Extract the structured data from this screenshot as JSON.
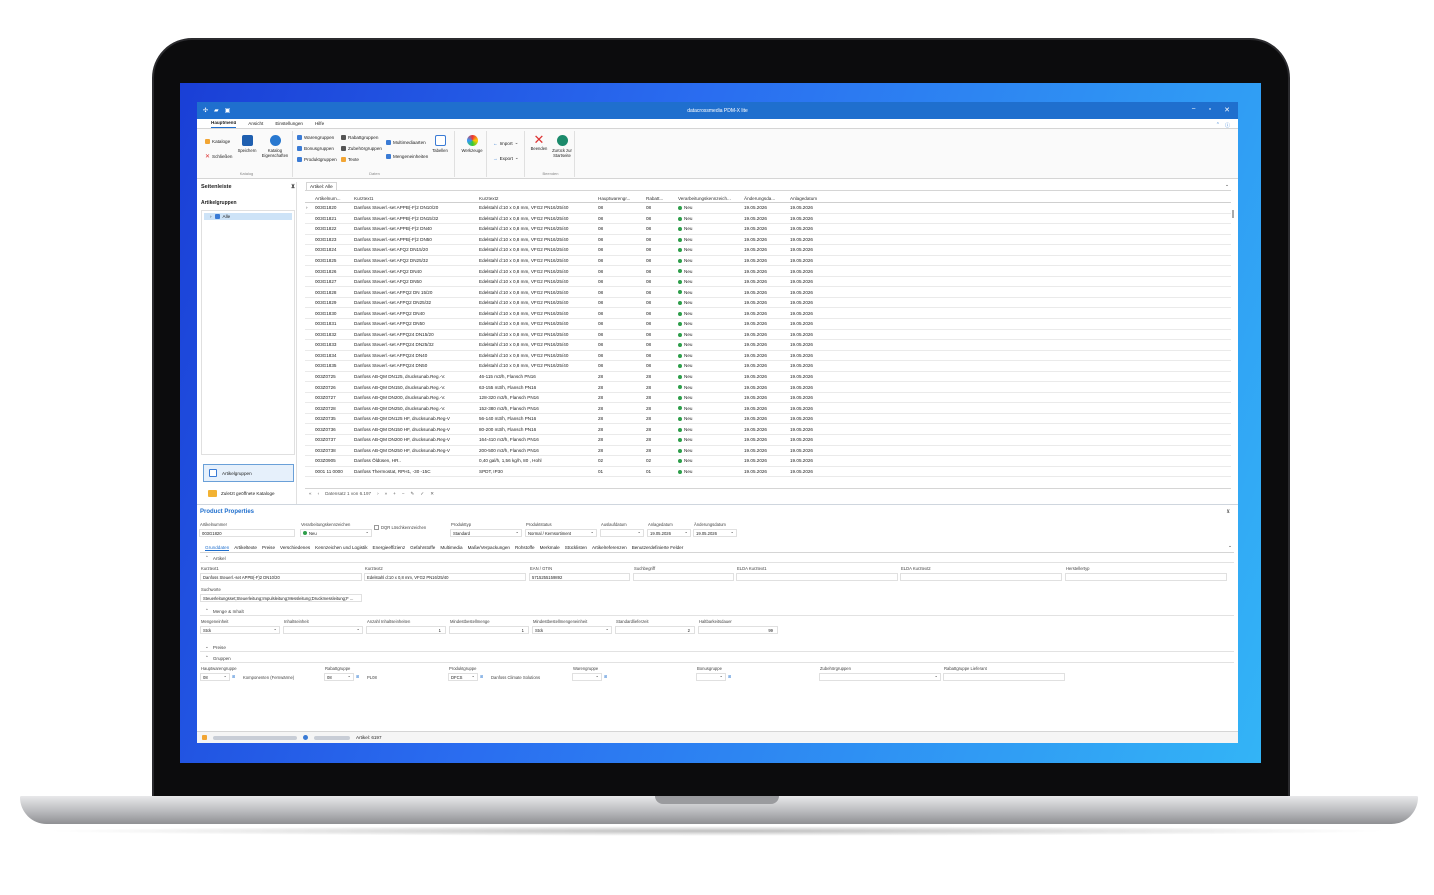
{
  "window": {
    "title": "datacrossmedia PDM-X lite",
    "minimize": "−",
    "restore": "▫",
    "close": "✕"
  },
  "menu": {
    "items": [
      "Hauptmenü",
      "Ansicht",
      "Einstellungen",
      "Hilfe"
    ]
  },
  "ribbon": {
    "katalog": {
      "name": "Katalog",
      "kataloge": "Kataloge",
      "schliessen": "Schließen",
      "speichern": "Speichern",
      "eigenschaften": "Katalog Eigenschaften"
    },
    "daten": {
      "name": "Daten",
      "warengruppen": "Warengruppen",
      "bonusgruppen": "Bonusgruppen",
      "produktgruppen": "Produktgruppen",
      "rabattgruppen": "Rabattgruppen",
      "zubehoergruppen": "Zubehörgruppen",
      "texte": "Texte",
      "multimediaarten": "Multimediaarten",
      "mengeneinheiten": "Mengeneinheiten",
      "tabellen": "Tabellen"
    },
    "werkzeuge": {
      "label": "Werkzeuge"
    },
    "io": {
      "import": "Import",
      "export": "Export"
    },
    "beenden": {
      "name": "Beenden",
      "beenden": "Beenden",
      "zurueck": "Zurück zur Startseite"
    }
  },
  "sidebar": {
    "title": "Seitenleiste",
    "section": "Artikelgruppen",
    "tree_item": "Alle",
    "nav_active": "Artikelgruppen",
    "nav_other": "Zuletzt geöffnete Kataloge"
  },
  "grid": {
    "tab": "Artikel: Alle",
    "columns": [
      "Artikelnum...",
      "Kurztext1",
      "Kurztext2",
      "Hauptwarengr...",
      "Rabatt...",
      "Verarbeitungskennzeich...",
      "Änderungsda...",
      "Anlagedatum"
    ],
    "rows": [
      [
        "003G1820",
        "Danfoss Steuerl.-set APPB(-F)2 DN10/20",
        "Edelstahl d:10 x 0,8 mm, VFG2 PN16/25/40",
        "08",
        "08",
        "Neu",
        "19.05.2026",
        "19.05.2026"
      ],
      [
        "003G1821",
        "Danfoss Steuerl.-set APPB(-F)2 DN15/32",
        "Edelstahl d:10 x 0,8 mm, VFG2 PN16/25/40",
        "08",
        "08",
        "Neu",
        "19.05.2026",
        "19.05.2026"
      ],
      [
        "003G1822",
        "Danfoss Steuerl.-set APPB(-F)2 DN40",
        "Edelstahl d:10 x 0,8 mm, VFG2 PN16/25/40",
        "08",
        "08",
        "Neu",
        "19.05.2026",
        "19.05.2026"
      ],
      [
        "003G1823",
        "Danfoss Steuerl.-set APPB(-F)2 DN50",
        "Edelstahl d:10 x 0,8 mm, VFG2 PN16/25/40",
        "08",
        "08",
        "Neu",
        "19.05.2026",
        "19.05.2026"
      ],
      [
        "003G1824",
        "Danfoss Steuerl.-set AFQ2 DN15/20",
        "Edelstahl d:10 x 0,8 mm, VFG2 PN16/25/40",
        "08",
        "08",
        "Neu",
        "19.05.2026",
        "19.05.2026"
      ],
      [
        "003G1825",
        "Danfoss Steuerl.-set AFQ2 DN25/32",
        "Edelstahl d:10 x 0,8 mm, VFG2 PN16/25/40",
        "08",
        "08",
        "Neu",
        "19.05.2026",
        "19.05.2026"
      ],
      [
        "003G1826",
        "Danfoss Steuerl.-set AFQ2 DN40",
        "Edelstahl d:10 x 0,8 mm, VFG2 PN16/25/40",
        "08",
        "08",
        "Neu",
        "19.05.2026",
        "19.05.2026"
      ],
      [
        "003G1827",
        "Danfoss Steuerl.-set AFQ2 DN50",
        "Edelstahl d:10 x 0,8 mm, VFG2 PN16/25/40",
        "08",
        "08",
        "Neu",
        "19.05.2026",
        "19.05.2026"
      ],
      [
        "003G1828",
        "Danfoss Steuerl.-set AFPQ2 DN 15/20",
        "Edelstahl d:10 x 0,8 mm, VFG2 PN16/25/40",
        "08",
        "08",
        "Neu",
        "19.05.2026",
        "19.05.2026"
      ],
      [
        "003G1829",
        "Danfoss Steuerl.-set AFPQ2 DN25/32",
        "Edelstahl d:10 x 0,8 mm, VFG2 PN16/25/40",
        "08",
        "08",
        "Neu",
        "19.05.2026",
        "19.05.2026"
      ],
      [
        "003G1830",
        "Danfoss Steuerl.-set AFPQ2 DN40",
        "Edelstahl d:10 x 0,8 mm, VFG2 PN16/25/40",
        "08",
        "08",
        "Neu",
        "19.05.2026",
        "19.05.2026"
      ],
      [
        "003G1831",
        "Danfoss Steuerl.-set AFPQ2 DN50",
        "Edelstahl d:10 x 0,8 mm, VFG2 PN16/25/40",
        "08",
        "08",
        "Neu",
        "19.05.2026",
        "19.05.2026"
      ],
      [
        "003G1832",
        "Danfoss Steuerl.-set AFPQ24 DN15/20",
        "Edelstahl d:10 x 0,8 mm, VFG2 PN16/25/40",
        "08",
        "08",
        "Neu",
        "19.05.2026",
        "19.05.2026"
      ],
      [
        "003G1833",
        "Danfoss Steuerl.-set AFPQ24 DN25/32",
        "Edelstahl d:10 x 0,8 mm, VFG2 PN16/25/40",
        "08",
        "08",
        "Neu",
        "19.05.2026",
        "19.05.2026"
      ],
      [
        "003G1834",
        "Danfoss Steuerl.-set AFPQ24 DN40",
        "Edelstahl d:10 x 0,8 mm, VFG2 PN16/25/40",
        "08",
        "08",
        "Neu",
        "19.05.2026",
        "19.05.2026"
      ],
      [
        "003G1835",
        "Danfoss Steuerl.-set AFPQ24 DN50",
        "Edelstahl d:10 x 0,8 mm, VFG2 PN16/25/40",
        "08",
        "08",
        "Neu",
        "19.05.2026",
        "19.05.2026"
      ],
      [
        "003Z0725",
        "Danfoss AB-QM DN125, drucksunab.Reg.-V.",
        "46-115 m3/h, Flansch PN16",
        "28",
        "28",
        "Neu",
        "19.05.2026",
        "19.05.2026"
      ],
      [
        "003Z0726",
        "Danfoss AB-QM DN150, drucksunab.Reg.-V.",
        "63-155 m3/h, Flansch PN16",
        "28",
        "28",
        "Neu",
        "19.05.2026",
        "19.05.2026"
      ],
      [
        "003Z0727",
        "Danfoss AB-QM DN200, drucksunab.Reg.-V.",
        "128-320 m3/h, Flansch PN16",
        "28",
        "28",
        "Neu",
        "19.05.2026",
        "19.05.2026"
      ],
      [
        "003Z0728",
        "Danfoss AB-QM DN250, drucksunab.Reg.-V.",
        "152-380 m3/h, Flansch PN16",
        "28",
        "28",
        "Neu",
        "19.05.2026",
        "19.05.2026"
      ],
      [
        "003Z0735",
        "Danfoss AB-QM DN125 HF, drucksunab.Reg-V",
        "56-140 m3/h, Flansch PN16",
        "28",
        "28",
        "Neu",
        "19.05.2026",
        "19.05.2026"
      ],
      [
        "003Z0736",
        "Danfoss AB-QM DN150 HF, drucksunab.Reg-V",
        "80-200 m3/h, Flansch PN16",
        "28",
        "28",
        "Neu",
        "19.05.2026",
        "19.05.2026"
      ],
      [
        "003Z0737",
        "Danfoss AB-QM DN200 HF, drucksunab.Reg-V",
        "164-410 m3/h, Flansch PN16",
        "28",
        "28",
        "Neu",
        "19.05.2026",
        "19.05.2026"
      ],
      [
        "003Z0738",
        "Danfoss AB-QM DN250 HF, drucksunab.Reg-V",
        "200-500 m3/h, Flansch PN16",
        "28",
        "28",
        "Neu",
        "19.05.2026",
        "19.05.2026"
      ],
      [
        "003Z0905",
        "Danfoss Öldüsen, HR..",
        "0,40 gal/h, 1,56 kg/h, 80 , Hohl",
        "02",
        "02",
        "Neu",
        "19.05.2026",
        "19.05.2026"
      ],
      [
        "0001 11 0000",
        "Danfoss Thermostat, RPH1, -30 -15C",
        "SPDT, IP30",
        "01",
        "01",
        "Neu",
        "19.05.2026",
        "19.05.2026"
      ]
    ],
    "pager": {
      "text": "Datensatz 1 von 6.197",
      "nav_first": "«",
      "nav_prev": "‹",
      "nav_next": "›",
      "nav_last": "»"
    }
  },
  "properties": {
    "title": "Product Properties",
    "artikelnummer": {
      "label": "Artikelnummer",
      "value": "003G1820"
    },
    "verarbeitung": {
      "label": "Verarbeitungskennzeichen",
      "value": "Neu"
    },
    "dqr": {
      "label": "DQR Löschkennzeichen"
    },
    "produkttyp": {
      "label": "Produkttyp",
      "value": "Standard"
    },
    "produktstatus": {
      "label": "Produktstatus",
      "value": "Normal / Kernsortiment"
    },
    "auslaufdatum": {
      "label": "Auslaufdatum",
      "value": ""
    },
    "anlagedatum": {
      "label": "Anlagedatum",
      "value": "19.05.2026"
    },
    "aenderungsdatum": {
      "label": "Änderungsdatum",
      "value": "19.05.2026"
    },
    "tabs": [
      "Grunddaten",
      "Artikeltexte",
      "Preise",
      "Verschiedenes",
      "Kennzeichen und Logistik",
      "Energieeffizienz",
      "Gefahrstoffe",
      "Multimedia",
      "Maße/Verpackungen",
      "Rohstoffe",
      "Merkmale",
      "Stücklisten",
      "Artikelreferenzen",
      "Benutzerdefinierte Felder"
    ],
    "sec_artikel": "Artikel",
    "kurztext1": {
      "label": "Kurztext1",
      "value": "Danfoss Steuerl.-set APPB(-F)2 DN10/20"
    },
    "kurztext2": {
      "label": "Kurztext2",
      "value": "Edelstahl d:10 x 0,8 mm, VFG2 PN16/25/40"
    },
    "ean": {
      "label": "EAN / GTIN",
      "value": "5715255159892"
    },
    "suchbegriff": {
      "label": "Suchbegriff",
      "value": ""
    },
    "elda1": {
      "label": "ELDA Kurztext1",
      "value": ""
    },
    "elda2": {
      "label": "ELDA Kurztext2",
      "value": ""
    },
    "herstellertyp": {
      "label": "Herstellertyp",
      "value": ""
    },
    "suchworte": {
      "label": "Suchworte",
      "value": "Steuerleitungsset;Steuerleitung;Impulsleitung;Messleitung;Druckmessleitung;F ..."
    },
    "sec_menge": "Menge & Inhalt",
    "mengeneinheit": {
      "label": "Mengeneinheit",
      "value": "Stck"
    },
    "inhaltseinheit": {
      "label": "Inhaltseinheit",
      "value": ""
    },
    "anzahl": {
      "label": "Anzahl Inhaltseinheiten",
      "value": "1"
    },
    "mindestbestell": {
      "label": "Mindestbestellmenge",
      "value": "1"
    },
    "mindestbestelleinheit": {
      "label": "Mindestbestellmengeneinheit",
      "value": "Stck"
    },
    "lieferzeit": {
      "label": "Standardlieferzeit",
      "value": "2"
    },
    "haltbarkeit": {
      "label": "Haltbarkeitsdauer",
      "value": "99"
    },
    "sec_preise": "Preise",
    "sec_gruppen": "Gruppen",
    "hauptwarengruppe": {
      "label": "Hauptwarengruppe",
      "value": "08",
      "text": "Komponenten (Fernwärme)"
    },
    "rabattgruppe": {
      "label": "Rabattgruppe",
      "value": "08",
      "text": "PL08"
    },
    "produktgruppe": {
      "label": "Produktgruppe",
      "value": "DFCS",
      "text": "Danfoss Climate Solutions"
    },
    "warengruppe": {
      "label": "Warengruppe",
      "value": ""
    },
    "bonusgruppe": {
      "label": "Bonusgruppe",
      "value": ""
    },
    "zubehoer": {
      "label": "Zubehörgruppen",
      "value": ""
    },
    "rabattlief": {
      "label": "Rabattgruppe Lieferant",
      "value": ""
    }
  },
  "status": {
    "articles": "Artikel: 6197"
  },
  "colors": {
    "accent": "#1f6fce",
    "status_new": "#2e9e4a"
  }
}
